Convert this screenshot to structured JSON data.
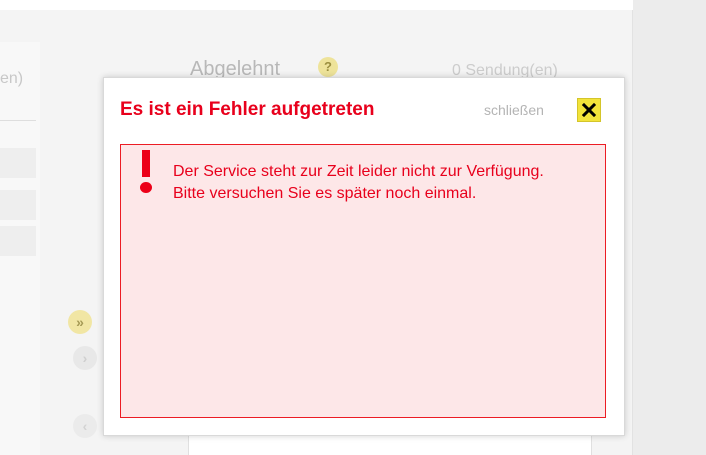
{
  "background": {
    "left_label": "en)",
    "heading": "Abgelehnt",
    "help_symbol": "?",
    "count_text": "0 Sendung(en)",
    "arrow_all_symbol": "»",
    "arrow_next_symbol": "›",
    "arrow_prev_symbol": "‹"
  },
  "dialog": {
    "title": "Es ist ein Fehler aufgetreten",
    "close_label": "schließen",
    "message": "Der Service steht zur Zeit leider nicht zur Verfügung. Bitte versuchen Sie es später noch einmal."
  },
  "colors": {
    "error_red": "#e8001c",
    "error_bg": "#fde7e8",
    "close_yellow": "#f2e33a"
  },
  "icons": {
    "close": "close-x-icon",
    "alert": "exclamation-icon"
  }
}
